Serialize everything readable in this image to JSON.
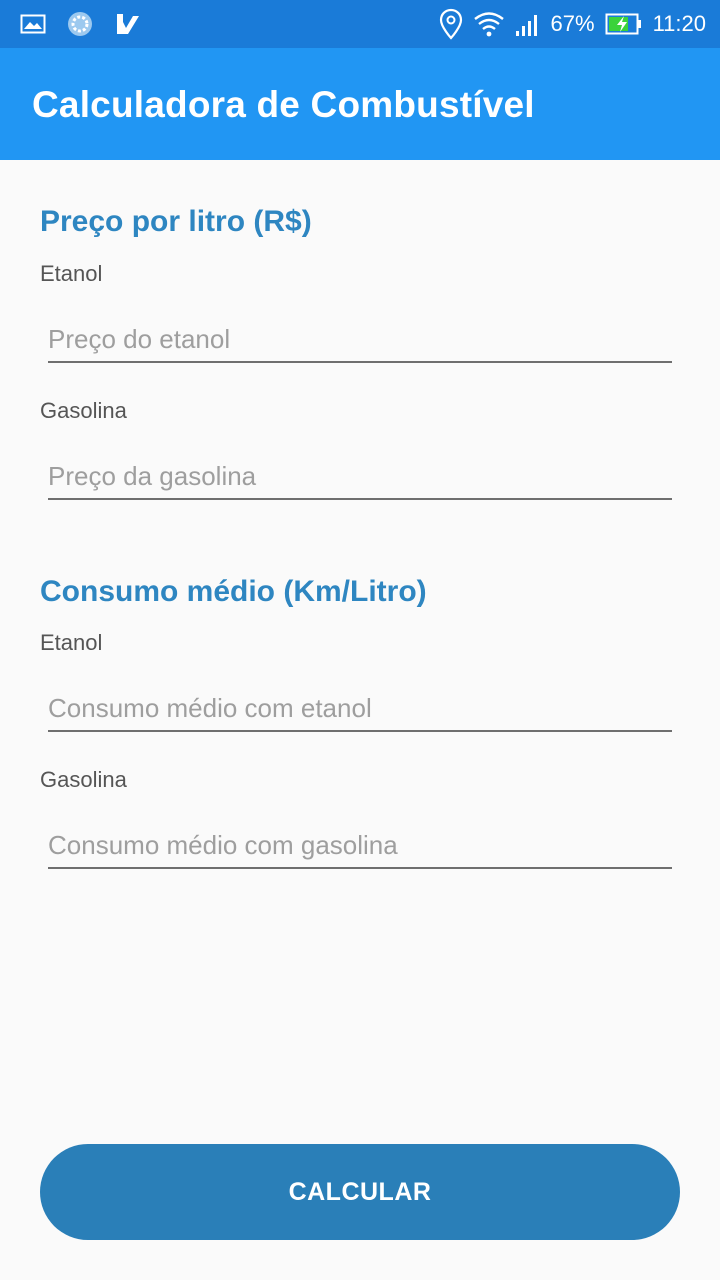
{
  "status_bar": {
    "battery_percent": "67%",
    "time": "11:20",
    "icons": [
      "image-icon",
      "sync-icon",
      "check-app-icon",
      "location-icon",
      "wifi-icon",
      "signal-icon",
      "battery-charging-icon"
    ]
  },
  "app_bar": {
    "title": "Calculadora de Combustível",
    "color": "#2196f3"
  },
  "price_section": {
    "title": "Preço por litro (R$)",
    "ethanol_label": "Etanol",
    "ethanol_placeholder": "Preço do etanol",
    "gasoline_label": "Gasolina",
    "gasoline_placeholder": "Preço da gasolina"
  },
  "consumption_section": {
    "title": "Consumo médio (Km/Litro)",
    "ethanol_label": "Etanol",
    "ethanol_placeholder": "Consumo médio com etanol",
    "gasoline_label": "Gasolina",
    "gasoline_placeholder": "Consumo médio com gasolina"
  },
  "button": {
    "label": "CALCULAR",
    "color": "#2a7fb8"
  }
}
